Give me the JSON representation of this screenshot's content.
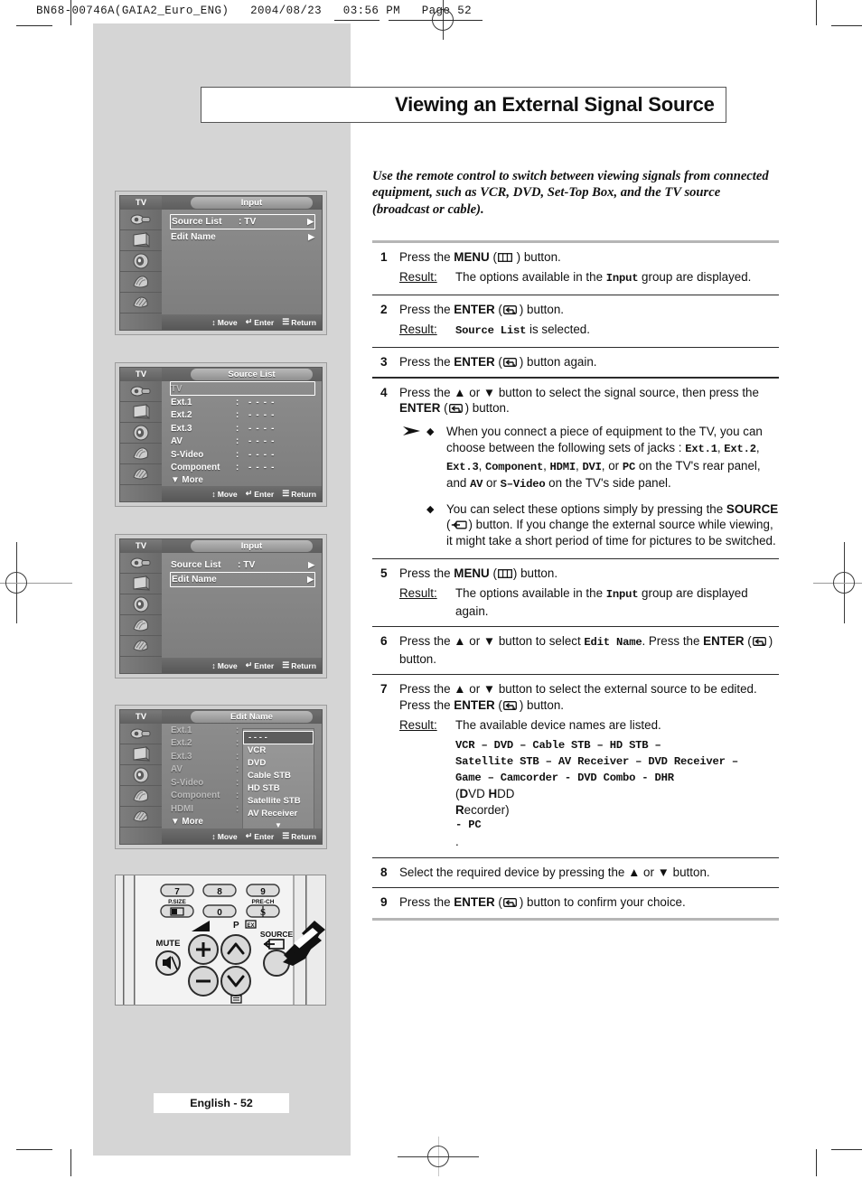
{
  "print_header": {
    "code": "BN68-00746A(GAIA2_Euro_ENG)",
    "date": "2004/08/23",
    "time": "03:56 PM",
    "page_label": "Page 52"
  },
  "page": {
    "title": "Viewing an External Signal Source",
    "intro": "Use the remote control to switch between viewing signals from connected equipment, such as VCR, DVD, Set-Top Box, and the TV source (broadcast or cable).",
    "footer": "English - 52"
  },
  "steps": [
    {
      "num": "1",
      "lines": [
        {
          "parts": [
            {
              "t": "Press the ",
              "s": "n"
            },
            {
              "t": "MENU",
              "s": "b"
            },
            {
              "t": " (",
              "s": "n"
            },
            {
              "t": "[menu-icon]",
              "s": "icon-menu"
            },
            {
              "t": " )  button.",
              "s": "n"
            }
          ]
        }
      ],
      "result_label": "Result:",
      "result_parts": [
        {
          "t": "The options available in the ",
          "s": "n"
        },
        {
          "t": "Input",
          "s": "m"
        },
        {
          "t": " group are displayed.",
          "s": "n"
        }
      ]
    },
    {
      "num": "2",
      "lines": [
        {
          "parts": [
            {
              "t": "Press the ",
              "s": "n"
            },
            {
              "t": "ENTER",
              "s": "b"
            },
            {
              "t": " (",
              "s": "n"
            },
            {
              "t": "[enter-icon]",
              "s": "icon-enter"
            },
            {
              "t": ") button.",
              "s": "n"
            }
          ]
        }
      ],
      "result_label": "Result:",
      "result_parts": [
        {
          "t": "Source List",
          "s": "m"
        },
        {
          "t": " is selected.",
          "s": "n"
        }
      ]
    },
    {
      "num": "3",
      "lines": [
        {
          "parts": [
            {
              "t": "Press the ",
              "s": "n"
            },
            {
              "t": "ENTER",
              "s": "b"
            },
            {
              "t": " (",
              "s": "n"
            },
            {
              "t": "[enter-icon]",
              "s": "icon-enter"
            },
            {
              "t": ") button again.",
              "s": "n"
            }
          ]
        }
      ]
    },
    {
      "num": "4",
      "lines": [
        {
          "parts": [
            {
              "t": "Press the ▲ or ▼ button to select the signal source, then press the ",
              "s": "n"
            },
            {
              "t": "ENTER",
              "s": "b"
            },
            {
              "t": " (",
              "s": "n"
            },
            {
              "t": "[enter-icon]",
              "s": "icon-enter"
            },
            {
              "t": ") button.",
              "s": "n"
            }
          ]
        }
      ],
      "notes": [
        {
          "parts": [
            {
              "t": "When you connect a piece of equipment to the TV, you can choose between the following sets of jacks : ",
              "s": "n"
            },
            {
              "t": "Ext.1",
              "s": "m"
            },
            {
              "t": ", ",
              "s": "n"
            },
            {
              "t": "Ext.2",
              "s": "m"
            },
            {
              "t": ", ",
              "s": "n"
            },
            {
              "t": "Ext.3",
              "s": "m"
            },
            {
              "t": ", ",
              "s": "n"
            },
            {
              "t": "Component",
              "s": "m"
            },
            {
              "t": ", ",
              "s": "n"
            },
            {
              "t": "HDMI",
              "s": "m"
            },
            {
              "t": ", ",
              "s": "n"
            },
            {
              "t": "DVI",
              "s": "m"
            },
            {
              "t": ", or ",
              "s": "n"
            },
            {
              "t": "PC",
              "s": "m"
            },
            {
              "t": " on the TV's rear panel, and ",
              "s": "n"
            },
            {
              "t": "AV",
              "s": "m"
            },
            {
              "t": " or ",
              "s": "n"
            },
            {
              "t": "S–Video",
              "s": "m"
            },
            {
              "t": " on the TV's side panel.",
              "s": "n"
            }
          ]
        },
        {
          "parts": [
            {
              "t": "You can select these options simply by pressing the ",
              "s": "n"
            },
            {
              "t": "SOURCE",
              "s": "b"
            },
            {
              "t": " (",
              "s": "n"
            },
            {
              "t": "[source-icon]",
              "s": "icon-source"
            },
            {
              "t": ") button. If you change the external source while viewing, it might take a short period of time for pictures to be switched.",
              "s": "n"
            }
          ]
        }
      ]
    },
    {
      "num": "5",
      "lines": [
        {
          "parts": [
            {
              "t": "Press the ",
              "s": "n"
            },
            {
              "t": "MENU",
              "s": "b"
            },
            {
              "t": " (",
              "s": "n"
            },
            {
              "t": "[menu-icon]",
              "s": "icon-menu"
            },
            {
              "t": ") button.",
              "s": "n"
            }
          ]
        }
      ],
      "result_label": "Result:",
      "result_parts": [
        {
          "t": "The options available in the ",
          "s": "n"
        },
        {
          "t": "Input",
          "s": "m"
        },
        {
          "t": " group are displayed again.",
          "s": "n"
        }
      ]
    },
    {
      "num": "6",
      "lines": [
        {
          "parts": [
            {
              "t": "Press the ▲ or ▼ button to select ",
              "s": "n"
            },
            {
              "t": "Edit Name",
              "s": "m"
            },
            {
              "t": ". Press the ",
              "s": "n"
            },
            {
              "t": "ENTER",
              "s": "b"
            },
            {
              "t": " (",
              "s": "n"
            },
            {
              "t": "[enter-icon]",
              "s": "icon-enter"
            },
            {
              "t": ") button.",
              "s": "n"
            }
          ]
        }
      ]
    },
    {
      "num": "7",
      "lines": [
        {
          "parts": [
            {
              "t": "Press the ▲ or ▼ button to select the external source to be edited. Press the ",
              "s": "n"
            },
            {
              "t": "ENTER",
              "s": "b"
            },
            {
              "t": " (",
              "s": "n"
            },
            {
              "t": "[enter-icon]",
              "s": "icon-enter"
            },
            {
              "t": ") button.",
              "s": "n"
            }
          ]
        }
      ],
      "result_label": "Result:",
      "result_parts": [
        {
          "t": "The available device names are listed.",
          "s": "n"
        }
      ],
      "device_list": [
        {
          "parts": [
            {
              "t": "VCR – DVD – Cable STB – HD STB –",
              "s": "m"
            }
          ]
        },
        {
          "parts": [
            {
              "t": "Satellite STB –  AV Receiver – DVD Receiver –",
              "s": "m"
            }
          ]
        },
        {
          "parts": [
            {
              "t": "Game – Camcorder - DVD Combo - DHR",
              "s": "m"
            },
            {
              "t": " (",
              "s": "n"
            },
            {
              "t": "D",
              "s": "b"
            },
            {
              "t": "VD ",
              "s": "n"
            },
            {
              "t": "H",
              "s": "b"
            },
            {
              "t": "DD",
              "s": "n"
            }
          ]
        },
        {
          "parts": [
            {
              "t": "R",
              "s": "b"
            },
            {
              "t": "ecorder)",
              "s": "n"
            },
            {
              "t": " - PC",
              "s": "m"
            },
            {
              "t": ".",
              "s": "n"
            }
          ]
        }
      ]
    },
    {
      "num": "8",
      "lines": [
        {
          "parts": [
            {
              "t": "Select the required device by pressing the ▲ or ▼ button.",
              "s": "n"
            }
          ]
        }
      ]
    },
    {
      "num": "9",
      "lines": [
        {
          "parts": [
            {
              "t": "Press the ",
              "s": "n"
            },
            {
              "t": "ENTER",
              "s": "b"
            },
            {
              "t": " (",
              "s": "n"
            },
            {
              "t": "[enter-icon]",
              "s": "icon-enter"
            },
            {
              "t": ") button to confirm your choice.",
              "s": "n"
            }
          ]
        }
      ]
    }
  ],
  "osd_common": {
    "tv_label": "TV",
    "footer": {
      "move": "Move",
      "enter": "Enter",
      "return": "Return"
    },
    "sidebar_icons": [
      "plug-icon",
      "picture-tube-icon",
      "speaker-icon",
      "setup-icon",
      "input-icon"
    ]
  },
  "osd_screens": [
    {
      "id": "input-menu-1",
      "title": "Input",
      "rows": [
        {
          "label": "Source List",
          "value": ": TV",
          "arrow": "▶",
          "selected": true
        },
        {
          "label": "Edit Name",
          "value": "",
          "arrow": "▶",
          "selected": false
        }
      ]
    },
    {
      "id": "source-list-menu",
      "title": "Source List",
      "rows": [
        {
          "label": "TV",
          "colon": "",
          "value": "",
          "selected": true,
          "dim": true
        },
        {
          "label": "Ext.1",
          "colon": ":",
          "value": "- - - -",
          "selected": false
        },
        {
          "label": "Ext.2",
          "colon": ":",
          "value": "- - - -",
          "selected": false
        },
        {
          "label": "Ext.3",
          "colon": ":",
          "value": "- - - -",
          "selected": false
        },
        {
          "label": "AV",
          "colon": ":",
          "value": "- - - -",
          "selected": false
        },
        {
          "label": "S-Video",
          "colon": ":",
          "value": "- - - -",
          "selected": false
        },
        {
          "label": "Component",
          "colon": ":",
          "value": "- - - -",
          "selected": false
        }
      ],
      "more": "▼ More"
    },
    {
      "id": "input-menu-2",
      "title": "Input",
      "rows": [
        {
          "label": "Source List",
          "value": ": TV",
          "arrow": "▶",
          "selected": false
        },
        {
          "label": "Edit Name",
          "value": "",
          "arrow": "▶",
          "selected": true
        }
      ]
    },
    {
      "id": "edit-name-menu",
      "title": "Edit Name",
      "rows": [
        {
          "label": "Ext.1",
          "colon": ":",
          "value": "",
          "selected": false,
          "dim": true
        },
        {
          "label": "Ext.2",
          "colon": ":",
          "value": "",
          "selected": false,
          "dim": true
        },
        {
          "label": "Ext.3",
          "colon": ":",
          "value": "",
          "selected": false,
          "dim": true
        },
        {
          "label": "AV",
          "colon": ":",
          "value": "",
          "selected": false,
          "dim": true
        },
        {
          "label": "S-Video",
          "colon": ":",
          "value": "",
          "selected": false,
          "dim": true
        },
        {
          "label": "Component",
          "colon": ":",
          "value": "",
          "selected": false,
          "dim": true
        },
        {
          "label": "HDMI",
          "colon": ":",
          "value": "",
          "selected": false,
          "dim": true
        }
      ],
      "more": "▼ More",
      "popup": {
        "items": [
          "- - - -",
          "VCR",
          "DVD",
          "Cable STB",
          "HD STB",
          "Satellite STB",
          "AV Receiver"
        ],
        "selected_index": 0,
        "more": "▼"
      }
    }
  ],
  "remote": {
    "keys": [
      "7",
      "8",
      "9",
      "0"
    ],
    "labels": {
      "psize": "P.SIZE",
      "prech": "PRE-CH",
      "mute": "MUTE",
      "prog": "P",
      "source": "SOURCE"
    }
  },
  "colors": {
    "page_margin_gray": "#d5d5d5",
    "rule_gray": "#b6b6b6",
    "rule_black": "#2b2b2b",
    "osd_bg": "#808080",
    "osd_highlight": "#ffffff"
  }
}
